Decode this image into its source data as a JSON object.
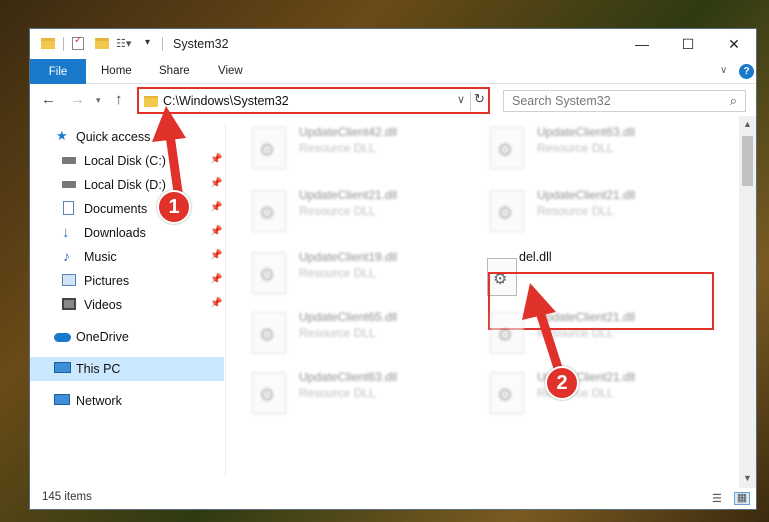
{
  "window": {
    "title": "System32",
    "controls": {
      "minimize": "—",
      "maximize": "☐",
      "close": "✕"
    }
  },
  "ribbon": {
    "tabs": [
      "File",
      "Home",
      "Share",
      "View"
    ],
    "help": "?"
  },
  "nav": {
    "address": "C:\\Windows\\System32",
    "search_placeholder": "Search System32"
  },
  "sidebar": {
    "items": [
      {
        "label": "Quick access",
        "icon": "star-icon",
        "pinned": false
      },
      {
        "label": "Local Disk (C:)",
        "icon": "drive-icon",
        "pinned": true
      },
      {
        "label": "Local Disk (D:)",
        "icon": "drive-icon",
        "pinned": true
      },
      {
        "label": "Documents",
        "icon": "document-icon",
        "pinned": true
      },
      {
        "label": "Downloads",
        "icon": "download-icon",
        "pinned": true
      },
      {
        "label": "Music",
        "icon": "music-icon",
        "pinned": true
      },
      {
        "label": "Pictures",
        "icon": "pictures-icon",
        "pinned": true
      },
      {
        "label": "Videos",
        "icon": "videos-icon",
        "pinned": true
      },
      {
        "label": "OneDrive",
        "icon": "cloud-icon",
        "pinned": false
      },
      {
        "label": "This PC",
        "icon": "computer-icon",
        "pinned": false,
        "selected": true
      },
      {
        "label": "Network",
        "icon": "network-icon",
        "pinned": false
      }
    ]
  },
  "files": [
    {
      "name": "UpdateClient42.dll",
      "type": "Resource DLL"
    },
    {
      "name": "UpdateClient63.dll",
      "type": "Resource DLL"
    },
    {
      "name": "UpdateClient21.dll",
      "type": "Resource DLL"
    },
    {
      "name": "UpdateClient21.dll",
      "type": "Resource DLL"
    },
    {
      "name": "UpdateClient19.dll",
      "type": "Resource DLL"
    },
    {
      "name": "del.dll",
      "type": ""
    },
    {
      "name": "UpdateClient65.dll",
      "type": "Resource DLL"
    },
    {
      "name": "UpdateClient21.dll",
      "type": "Resource DLL"
    },
    {
      "name": "UpdateClient63.dll",
      "type": "Resource DLL"
    },
    {
      "name": "UpdateClient21.dll",
      "type": "Resource DLL"
    }
  ],
  "status": {
    "items_count": "145 items"
  },
  "callouts": [
    "1",
    "2"
  ],
  "colors": {
    "accent": "#1979ca",
    "highlight": "#e0312b",
    "selected": "#cce8ff"
  }
}
